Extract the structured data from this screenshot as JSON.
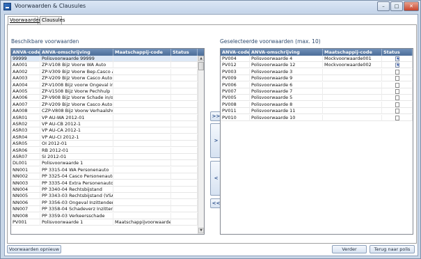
{
  "window": {
    "title": "Voorwaarden & Clausules",
    "min_label": "–",
    "max_label": "□",
    "close_label": "✕"
  },
  "tabs": [
    {
      "label": "Voorwaarden",
      "active": true
    },
    {
      "label": "Clausules",
      "active": false
    }
  ],
  "left_panel": {
    "title": "Beschikbare voorwaarden",
    "columns": [
      "ANVA-code",
      "ANVA-omschrijving",
      "Maatschappij-code",
      "Status"
    ],
    "rows": [
      [
        "99999",
        "Polisvoorwaarde 99999",
        "",
        ""
      ],
      [
        "AA001",
        "ZP-V108 Bijz Voorw WA Auto",
        "",
        ""
      ],
      [
        "AA002",
        "ZP-V309 Bijz Voorw Bep.Casco Auto",
        "",
        ""
      ],
      [
        "AA003",
        "ZP-V209 Bijz Voorw Casco Auto",
        "",
        ""
      ],
      [
        "AA004",
        "ZP-V1008 Bijz voorw Ongeval in/opz",
        "",
        ""
      ],
      [
        "AA005",
        "ZP-V1508 Bijz Voorw Pechhulp",
        "",
        ""
      ],
      [
        "AA006",
        "ZP-V908 Bijz Voorw Schade in/opzit",
        "",
        ""
      ],
      [
        "AA007",
        "ZP-V209 Bijz Voorw Casco Auto",
        "",
        ""
      ],
      [
        "AA008",
        "CZP-V808 Bijz Voorw Verhaalshulp",
        "",
        ""
      ],
      [
        "ASR01",
        "VP AU-WA 2012-01",
        "",
        ""
      ],
      [
        "ASR02",
        "VP AU-CB 2012-1",
        "",
        ""
      ],
      [
        "ASR03",
        "VP AU-CA 2012-1",
        "",
        ""
      ],
      [
        "ASR04",
        "VP AU-CI 2012-1",
        "",
        ""
      ],
      [
        "ASR05",
        "OI 2012-01",
        "",
        ""
      ],
      [
        "ASR06",
        "RB 2012-01",
        "",
        ""
      ],
      [
        "ASR07",
        "SI 2012-01",
        "",
        ""
      ],
      [
        "DL001",
        "Polisvoorwaarde 1",
        "",
        ""
      ],
      [
        "NN001",
        "PP 3315-04 WA Personenauto",
        "",
        ""
      ],
      [
        "NN002",
        "PP 3325-04 Casco Personenauto",
        "",
        ""
      ],
      [
        "NN003",
        "PP 3335-04 Extra Personenauto",
        "",
        ""
      ],
      [
        "NN004",
        "PP 3340-04 Rechtsbijstand",
        "",
        ""
      ],
      [
        "NN005",
        "PP 3343-03 Rechtsbijstand (VSA)",
        "",
        ""
      ],
      [
        "NN006",
        "PP 3356-03 Ongeval Inzittenden",
        "",
        ""
      ],
      [
        "NN007",
        "PP 3358-04 Schadeverz Inzittenden",
        "",
        ""
      ],
      [
        "NN008",
        "PP 3359-03 Verkeersschade",
        "",
        ""
      ],
      [
        "PV001",
        "Polisvoorwaarde 1",
        "Maatschappijvoorwaarde 1",
        ""
      ]
    ],
    "selected_row": 0
  },
  "right_panel": {
    "title": "Geselecteerde voorwaarden (max. 10)",
    "columns": [
      "ANVA-code",
      "ANVA-omschrijving",
      "Maatschappij-code",
      "Status"
    ],
    "rows": [
      [
        "PV004",
        "Polisvoorwaarde 4",
        "Mockvoorwaarde001",
        "starred-doc-icon"
      ],
      [
        "PV012",
        "Polisvoorwaarde 12",
        "Mockvoorwaarde002",
        "starred-doc-icon"
      ],
      [
        "PV003",
        "Polisvoorwaarde 3",
        "",
        "doc-icon"
      ],
      [
        "PV009",
        "Polisvoorwaarde 9",
        "",
        "doc-icon"
      ],
      [
        "PV006",
        "Polisvoorwaarde 6",
        "",
        "doc-icon"
      ],
      [
        "PV007",
        "Polisvoorwaarde 7",
        "",
        "doc-icon"
      ],
      [
        "PV005",
        "Polisvoorwaarde 5",
        "",
        "doc-icon"
      ],
      [
        "PV008",
        "Polisvoorwaarde 8",
        "",
        "doc-icon"
      ],
      [
        "PV011",
        "Polisvoorwaarde 11",
        "",
        "doc-icon"
      ],
      [
        "PV010",
        "Polisvoorwaarde 10",
        "",
        "doc-icon"
      ]
    ]
  },
  "move_buttons": {
    "add_all": ">>",
    "add_one": ">",
    "remove_one": "<",
    "remove_all": "<<"
  },
  "footer": {
    "reset_label": "Voorwaarden opnieuw",
    "next_label": "Verder",
    "back_label": "Terug naar polis"
  },
  "colors": {
    "header_bg": "#5a7aa6",
    "window_bg": "#c9d7e8",
    "selected_row": "#dde8f6"
  }
}
